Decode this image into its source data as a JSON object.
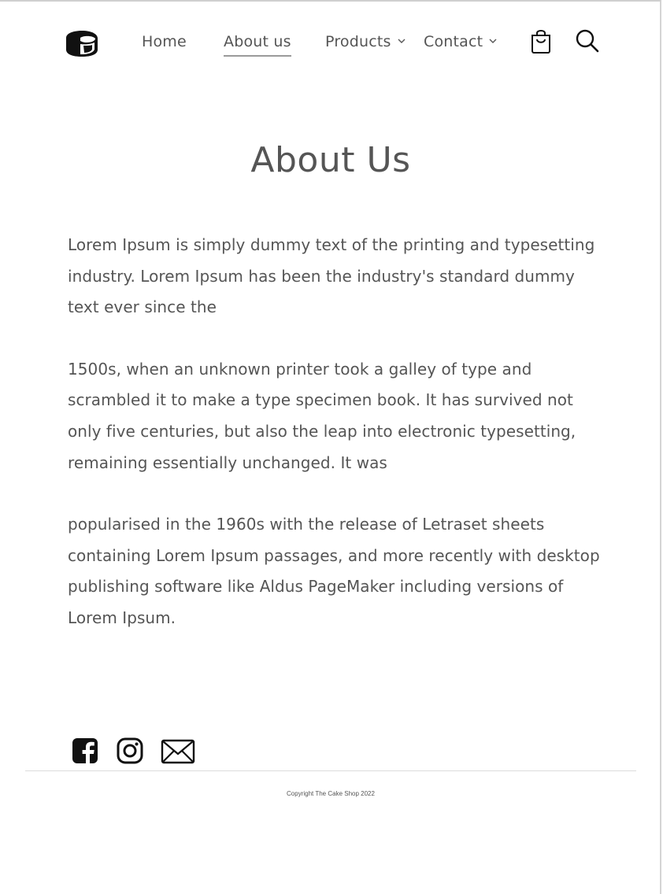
{
  "header": {
    "logo_icon": "cake-logo-icon",
    "nav": [
      {
        "label": "Home",
        "active": false,
        "has_dropdown": false
      },
      {
        "label": "About us",
        "active": true,
        "has_dropdown": false
      },
      {
        "label": "Products",
        "active": false,
        "has_dropdown": true
      },
      {
        "label": "Contact",
        "active": false,
        "has_dropdown": true
      }
    ],
    "cart_icon": "shopping-bag-icon",
    "search_icon": "search-icon"
  },
  "main": {
    "title": "About Us",
    "paragraphs": [
      "Lorem Ipsum is simply dummy text of the printing and typesetting industry. Lorem Ipsum has been the industry's standard dummy text ever since the",
      "1500s, when an unknown printer took a galley of type and scrambled it to make a type specimen book. It has survived not only five centuries, but also the leap into electronic typesetting, remaining essentially unchanged. It was",
      "popularised in the 1960s with the release of Letraset sheets containing Lorem Ipsum passages, and more recently with desktop publishing software like Aldus PageMaker including versions of Lorem Ipsum."
    ]
  },
  "footer": {
    "social": [
      {
        "icon": "facebook-icon"
      },
      {
        "icon": "instagram-icon"
      },
      {
        "icon": "mail-icon"
      }
    ],
    "copyright": "Copyright The Cake Shop 2022"
  },
  "colors": {
    "text": "#555555",
    "icon": "#111111",
    "divider": "#dcdcdc"
  }
}
